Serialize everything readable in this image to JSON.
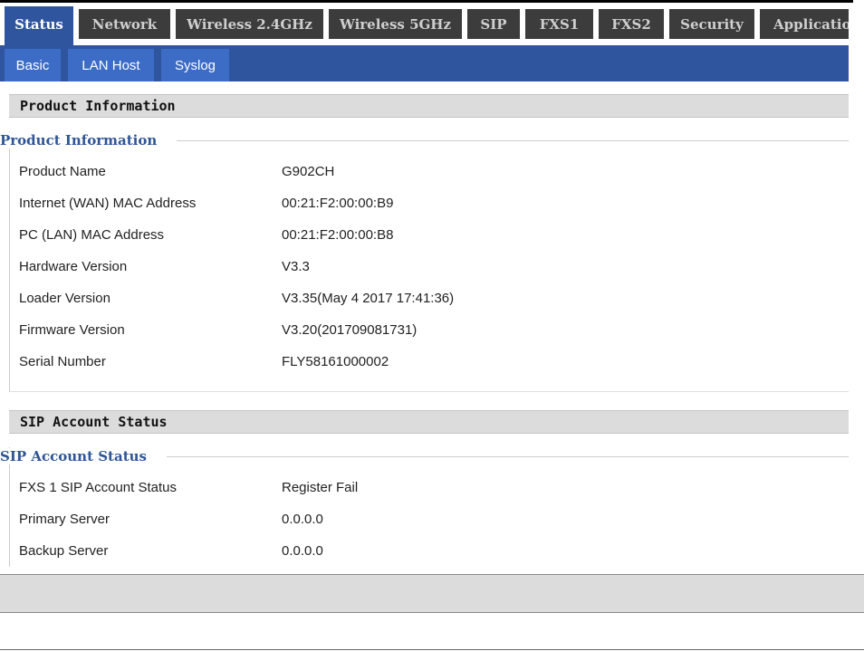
{
  "main_tabs": [
    "Status",
    "Network",
    "Wireless 2.4GHz",
    "Wireless 5GHz",
    "SIP",
    "FXS1",
    "FXS2",
    "Security",
    "Application"
  ],
  "sub_tabs": [
    "Basic",
    "LAN Host",
    "Syslog"
  ],
  "product_section": {
    "header": "Product Information",
    "legend": "Product Information",
    "rows": [
      {
        "label": "Product Name",
        "value": "G902CH"
      },
      {
        "label": "Internet (WAN) MAC Address",
        "value": "00:21:F2:00:00:B9"
      },
      {
        "label": "PC (LAN) MAC Address",
        "value": "00:21:F2:00:00:B8"
      },
      {
        "label": "Hardware Version",
        "value": "V3.3"
      },
      {
        "label": "Loader Version",
        "value": "V3.35(May 4 2017 17:41:36)"
      },
      {
        "label": "Firmware Version",
        "value": "V3.20(201709081731)"
      },
      {
        "label": "Serial Number",
        "value": "FLY58161000002"
      }
    ]
  },
  "sip_section": {
    "header": "SIP Account Status",
    "legend": "SIP Account Status",
    "rows": [
      {
        "label": "FXS 1 SIP Account Status",
        "value": "Register Fail"
      },
      {
        "label": "Primary Server",
        "value": "0.0.0.0"
      },
      {
        "label": "Backup Server",
        "value": "0.0.0.0"
      }
    ]
  },
  "colors": {
    "active_tab": "#2f559e",
    "inactive_tab": "#3c3c3c",
    "sub_tab": "#3c6cc6",
    "legend_text": "#2f5597"
  }
}
